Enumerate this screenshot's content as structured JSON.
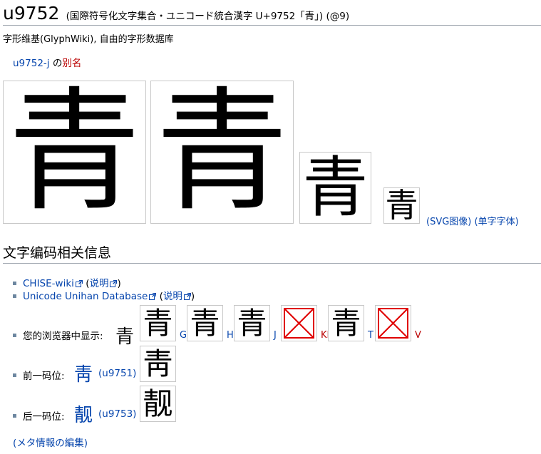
{
  "title": {
    "main": "u9752",
    "sub": "(国際符号化文字集合・ユニコード統合漢字 U+9752「青」) (@9)"
  },
  "tagline": "字形维基(GlyphWiki), 自由的字形数据库",
  "alias": {
    "link": "u9752-j",
    "mid": " の",
    "red": "别名"
  },
  "glyph_char": "青",
  "svg_links": {
    "svg": "(SVG图像)",
    "font": "(单字字体)"
  },
  "section_title": "文字编码相关信息",
  "links": {
    "chise": "CHISE-wiki",
    "unihan": "Unicode Unihan Database",
    "explain_open": "(",
    "explain": "说明",
    "explain_close": ")"
  },
  "browser": {
    "label": "您的浏览器中显示:",
    "char": "青",
    "sources": [
      {
        "label": "G",
        "char": "青",
        "missing": false,
        "color": "#0645ad"
      },
      {
        "label": "H",
        "char": "青",
        "missing": false,
        "color": "#0645ad"
      },
      {
        "label": "J",
        "char": "青",
        "missing": false,
        "color": "#0645ad"
      },
      {
        "label": "KP",
        "char": "",
        "missing": true,
        "color": "#ba0000"
      },
      {
        "label": "T",
        "char": "青",
        "missing": false,
        "color": "#0645ad"
      },
      {
        "label": "V",
        "char": "",
        "missing": true,
        "color": "#ba0000"
      }
    ]
  },
  "prev": {
    "label": "前一码位:",
    "char": "靑",
    "code": "(u9751)",
    "box_char": "靑"
  },
  "next": {
    "label": "后一码位:",
    "char": "靓",
    "code": "(u9753)",
    "box_char": "靓"
  },
  "meta_link": "(メタ情報の編集)",
  "colors": {
    "link": "#0645ad",
    "redlink": "#ba0000",
    "missing_box": "#e00000",
    "rule": "#a2a9b1",
    "bullet": "#6d87a0"
  }
}
